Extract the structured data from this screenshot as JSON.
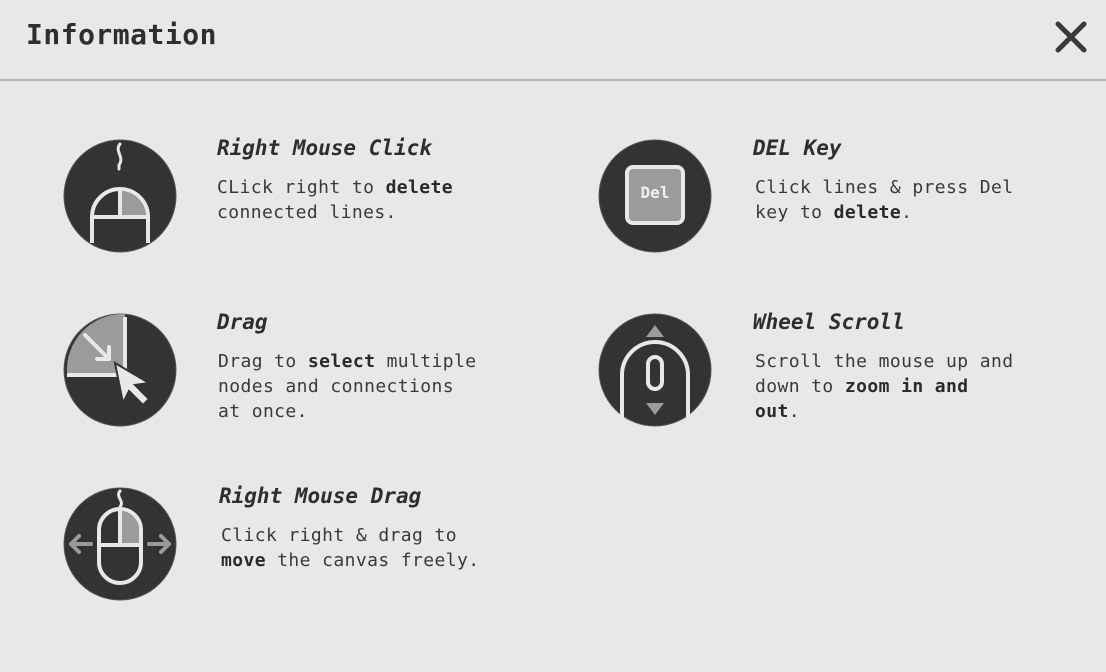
{
  "header": {
    "title": "Information"
  },
  "items": [
    {
      "title": "Right Mouse Click",
      "desc_line1_a": "CLick right to ",
      "desc_line1_b": "delete",
      "desc_line2": "connected lines.",
      "icon": "right-click-mouse-icon"
    },
    {
      "title": "DEL Key",
      "key_label": "Del",
      "desc_line1": "Click lines & press Del",
      "desc_line2_a": "key to ",
      "desc_line2_b": "delete",
      "desc_line2_c": ".",
      "icon": "del-key-icon"
    },
    {
      "title": "Drag",
      "desc_line1_a": "Drag to ",
      "desc_line1_b": "select",
      "desc_line1_c": " multiple",
      "desc_line2": "nodes and connections",
      "desc_line3": "at once.",
      "icon": "drag-select-icon"
    },
    {
      "title": "Wheel Scroll",
      "desc_line1": "Scroll the mouse up and",
      "desc_line2_a": "down to ",
      "desc_line2_b": "zoom in and",
      "desc_line3_a": "out",
      "desc_line3_b": ".",
      "icon": "mouse-wheel-icon"
    },
    {
      "title": "Right Mouse Drag",
      "desc_line1": "Click right & drag to",
      "desc_line2_a": "move",
      "desc_line2_b": " the canvas freely.",
      "icon": "right-drag-mouse-icon"
    }
  ],
  "colors": {
    "background": "#e8e8e8",
    "icon_dark": "#333333",
    "icon_light": "#e8e8e8",
    "icon_accent": "#9b9b9b",
    "text": "#2e2e2e"
  }
}
